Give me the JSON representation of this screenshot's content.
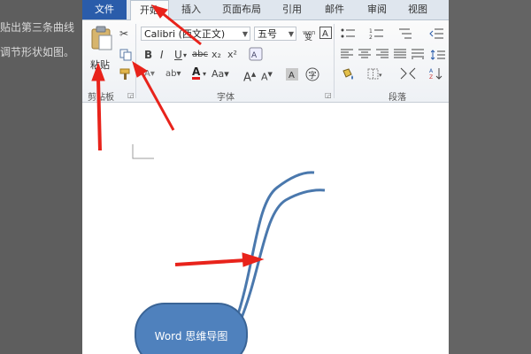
{
  "background_text": [
    "贴出第三条曲线",
    "调节形状如图。"
  ],
  "tabs": {
    "file": "文件",
    "home": "开始",
    "insert": "插入",
    "layout": "页面布局",
    "references": "引用",
    "mailings": "邮件",
    "review": "审阅",
    "view": "视图"
  },
  "clipboard": {
    "paste_label": "粘贴",
    "group_label": "剪贴板"
  },
  "font": {
    "font_name": "Calibri (西文正文)",
    "font_size": "五号",
    "group_label": "字体"
  },
  "paragraph": {
    "group_label": "段落"
  },
  "document": {
    "shape_text": "Word 思维导图",
    "shape_fill": "#4f81bd",
    "curve_color": "#4a78ad"
  },
  "annotation_color": "#e8231b"
}
